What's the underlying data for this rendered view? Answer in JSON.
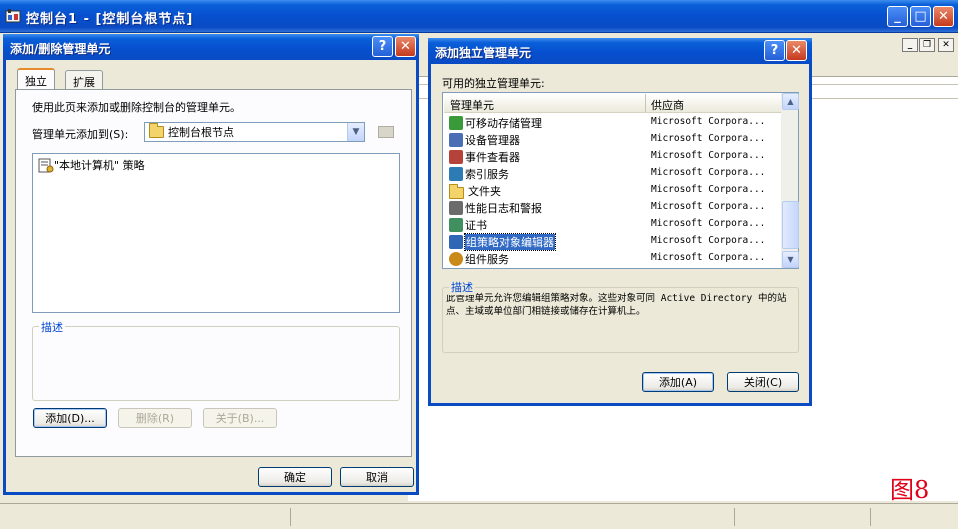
{
  "main_window": {
    "title": "控制台1 - [控制台根节点]",
    "minimize": "_",
    "maximize": "□",
    "close": "✕"
  },
  "mdi_buttons": {
    "minimize": "_",
    "restore": "❐",
    "close": "✕"
  },
  "figure_label": "图8",
  "add_remove_dialog": {
    "title": "添加/删除管理单元",
    "help": "?",
    "close": "✕",
    "tabs": [
      "独立",
      "扩展"
    ],
    "instruction": "使用此页来添加或删除控制台的管理单元。",
    "add_to_label": "管理单元添加到(S):",
    "add_to_value": "控制台根节点",
    "snapins": [
      "\"本地计算机\" 策略"
    ],
    "description_label": "描述",
    "buttons": {
      "add": "添加(D)...",
      "remove": "删除(R)",
      "about": "关于(B)..."
    },
    "ok": "确定",
    "cancel": "取消"
  },
  "standalone_dialog": {
    "title": "添加独立管理单元",
    "help": "?",
    "close": "✕",
    "available_label": "可用的独立管理单元:",
    "columns": [
      "管理单元",
      "供应商"
    ],
    "rows": [
      {
        "name": "可移动存储管理",
        "vendor": "Microsoft Corpora...",
        "icon": "removable-storage-icon",
        "color": "#3a9a3a"
      },
      {
        "name": "设备管理器",
        "vendor": "Microsoft Corpora...",
        "icon": "device-manager-icon",
        "color": "#4a6fb5"
      },
      {
        "name": "事件查看器",
        "vendor": "Microsoft Corpora...",
        "icon": "event-viewer-icon",
        "color": "#b5433a"
      },
      {
        "name": "索引服务",
        "vendor": "Microsoft Corpora...",
        "icon": "indexing-service-icon",
        "color": "#2c7bb5"
      },
      {
        "name": "文件夹",
        "vendor": "Microsoft Corpora...",
        "icon": "folder-icon",
        "color": "#f3d46a"
      },
      {
        "name": "性能日志和警报",
        "vendor": "Microsoft Corpora...",
        "icon": "performance-log-icon",
        "color": "#6b6b6b"
      },
      {
        "name": "证书",
        "vendor": "Microsoft Corpora...",
        "icon": "certificate-icon",
        "color": "#3f8f5f"
      },
      {
        "name": "组策略对象编辑器",
        "vendor": "Microsoft Corpora...",
        "icon": "group-policy-icon",
        "color": "#2f66b5",
        "selected": true
      },
      {
        "name": "组件服务",
        "vendor": "Microsoft Corpora...",
        "icon": "component-services-icon",
        "color": "#c98a1a"
      }
    ],
    "description_label": "描述",
    "description_text": "此管理单元允许您编辑组策略对象。这些对象可同 Active Directory 中的站点、主域或单位部门相链接或储存在计算机上。",
    "add": "添加(A)",
    "close_button": "关闭(C)"
  }
}
